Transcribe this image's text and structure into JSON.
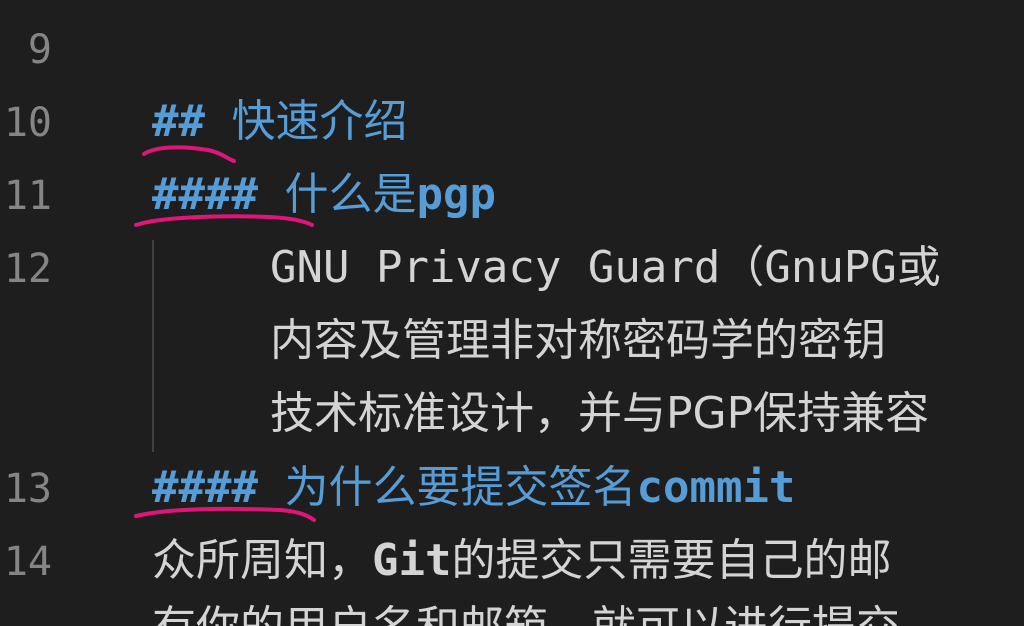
{
  "editor": {
    "lines": [
      {
        "number": "9"
      },
      {
        "number": "10",
        "hashes": "##",
        "text": "快速介绍",
        "latin": ""
      },
      {
        "number": "11",
        "hashes": "####",
        "text": "什么是",
        "latin": "pgp"
      },
      {
        "number": "12",
        "wrapped": [
          "GNU Privacy Guard（GnuPG或",
          "内容及管理非对称密码学的密钥",
          "技术标准设计，并与PGP保持兼容"
        ]
      },
      {
        "number": "13",
        "hashes": "####",
        "text": "为什么要提交签名",
        "latin": "commit"
      },
      {
        "number": "14",
        "pre": "众所周知，",
        "bold": "Git",
        "post": "的提交只需要自己的邮",
        "next": "有你的用户名和邮箱，就可以进行提交"
      }
    ]
  },
  "colors": {
    "background": "#1e1e1e",
    "heading": "#569cd6",
    "text": "#d4d4d4",
    "line_number": "#858585",
    "annotation": "#e0157a"
  }
}
